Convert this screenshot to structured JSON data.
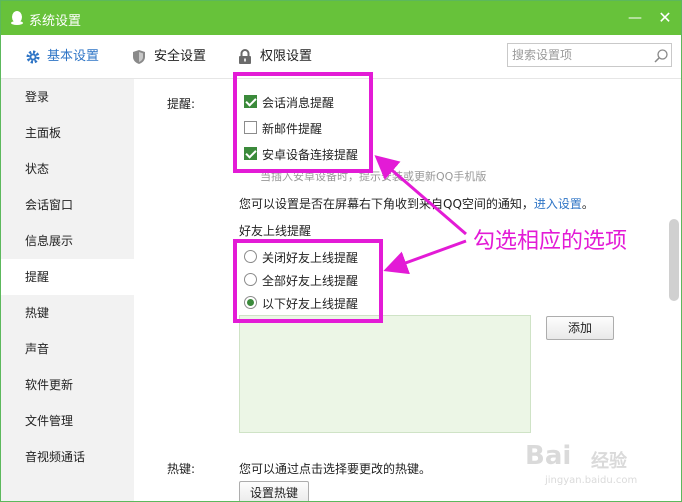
{
  "window": {
    "title": "系统设置",
    "minimize": "—",
    "close": "✕"
  },
  "tabs": [
    {
      "label": "基本设置",
      "icon": "gear-icon",
      "active": true
    },
    {
      "label": "安全设置",
      "icon": "shield-icon",
      "active": false
    },
    {
      "label": "权限设置",
      "icon": "lock-icon",
      "active": false
    }
  ],
  "search": {
    "placeholder": "搜索设置项",
    "value": ""
  },
  "sidebar": {
    "items": [
      {
        "label": "登录"
      },
      {
        "label": "主面板"
      },
      {
        "label": "状态"
      },
      {
        "label": "会话窗口"
      },
      {
        "label": "信息展示"
      },
      {
        "label": "提醒",
        "active": true
      },
      {
        "label": "热键"
      },
      {
        "label": "声音"
      },
      {
        "label": "软件更新"
      },
      {
        "label": "文件管理"
      },
      {
        "label": "音视频通话"
      }
    ]
  },
  "reminder": {
    "section_label": "提醒:",
    "checkboxes": [
      {
        "label": "会话消息提醒",
        "checked": true
      },
      {
        "label": "新邮件提醒",
        "checked": false
      },
      {
        "label": "安卓设备连接提醒",
        "checked": true
      }
    ],
    "android_hint": "当插入安卓设备时，提示安装或更新QQ手机版",
    "space_notice": "您可以设置是否在屏幕右下角收到来自QQ空间的通知，",
    "space_link": "进入设置",
    "space_end": "。",
    "friend_online_title": "好友上线提醒",
    "radios": [
      {
        "label": "关闭好友上线提醒",
        "checked": false
      },
      {
        "label": "全部好友上线提醒",
        "checked": false
      },
      {
        "label": "以下好友上线提醒",
        "checked": true
      }
    ],
    "add_button": "添加"
  },
  "hotkey": {
    "section_label": "热键:",
    "description": "您可以通过点击选择要更改的热键。",
    "button": "设置热键"
  },
  "annotation": {
    "text": "勾选相应的选项",
    "color": "#e31bd6"
  },
  "watermark": {
    "brand": "Bai",
    "brand2": "经验",
    "url": "jingyan.baidu.com"
  },
  "colors": {
    "titlebar": "#67c23a",
    "accent": "#2f75c6",
    "highlight": "#e31bd6"
  }
}
